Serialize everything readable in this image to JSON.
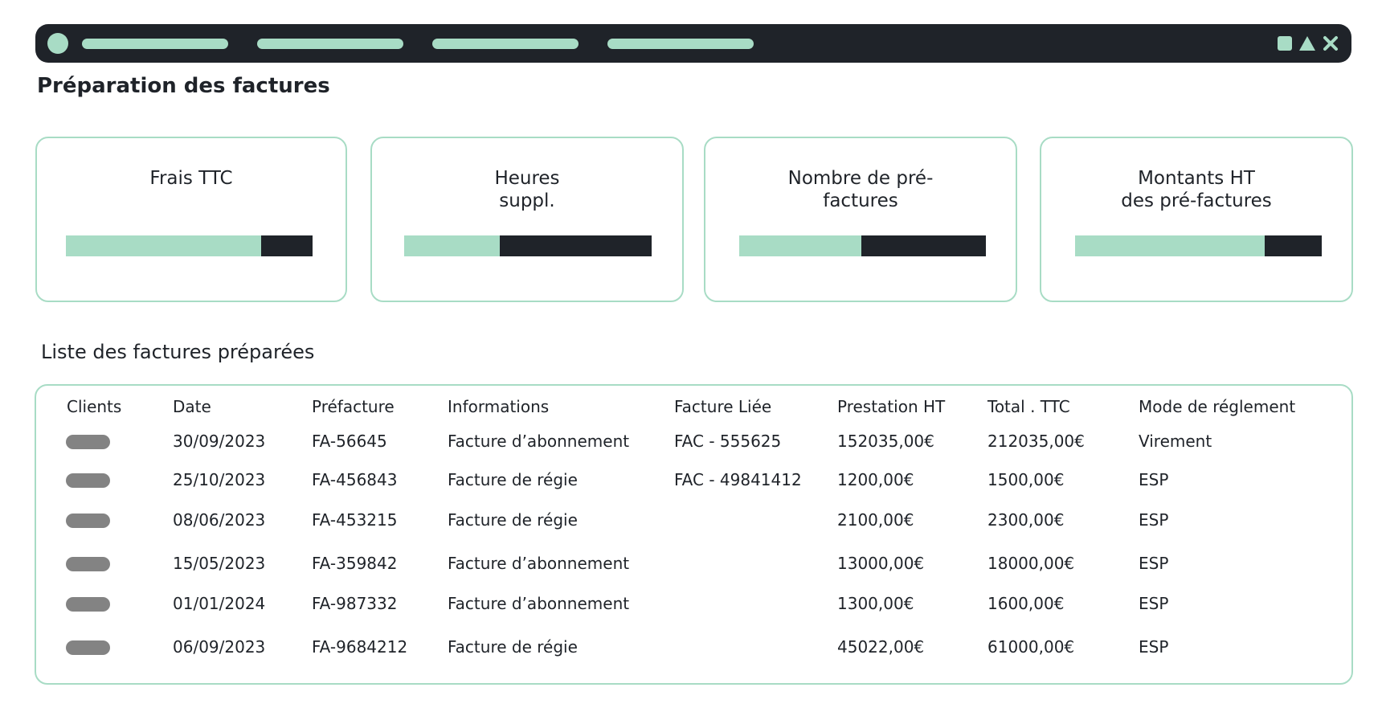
{
  "window": {
    "colors": {
      "bar": "#1f2329",
      "accent": "#a8dcc5"
    },
    "icons": [
      "circle-icon",
      "square-icon",
      "triangle-icon",
      "close-icon"
    ]
  },
  "page": {
    "title": "Préparation des factures"
  },
  "kpis": [
    {
      "label": "Frais TTC",
      "fill_fraction": 0.79
    },
    {
      "label": "Heures\nsuppl.",
      "fill_fraction": 0.385
    },
    {
      "label": "Nombre de pré-\nfactures",
      "fill_fraction": 0.495
    },
    {
      "label": "Montants HT\ndes pré-factures",
      "fill_fraction": 0.77
    }
  ],
  "invoices": {
    "title": "Liste des factures préparées",
    "columns": [
      "Clients",
      "Date",
      "Préfacture",
      "Informations",
      "Facture Liée",
      "Prestation HT",
      "Total . TTC",
      "Mode de réglement"
    ],
    "rows": [
      {
        "date": "30/09/2023",
        "prefacture": "FA-56645",
        "info": "Facture d’abonnement",
        "linked": "FAC - 555625",
        "ht": "152035,00€",
        "ttc": "212035,00€",
        "mode": "Virement"
      },
      {
        "date": "25/10/2023",
        "prefacture": "FA-456843",
        "info": "Facture de régie",
        "linked": "FAC - 49841412",
        "ht": "1200,00€",
        "ttc": "1500,00€",
        "mode": "ESP"
      },
      {
        "date": "08/06/2023",
        "prefacture": "FA-453215",
        "info": "Facture de régie",
        "linked": "",
        "ht": "2100,00€",
        "ttc": "2300,00€",
        "mode": "ESP"
      },
      {
        "date": "15/05/2023",
        "prefacture": "FA-359842",
        "info": "Facture d’abonnement",
        "linked": "",
        "ht": "13000,00€",
        "ttc": "18000,00€",
        "mode": "ESP"
      },
      {
        "date": "01/01/2024",
        "prefacture": "FA-987332",
        "info": "Facture d’abonnement",
        "linked": "",
        "ht": "1300,00€",
        "ttc": "1600,00€",
        "mode": "ESP"
      },
      {
        "date": "06/09/2023",
        "prefacture": "FA-9684212",
        "info": "Facture de régie",
        "linked": "",
        "ht": "45022,00€",
        "ttc": "61000,00€",
        "mode": "ESP"
      }
    ]
  }
}
